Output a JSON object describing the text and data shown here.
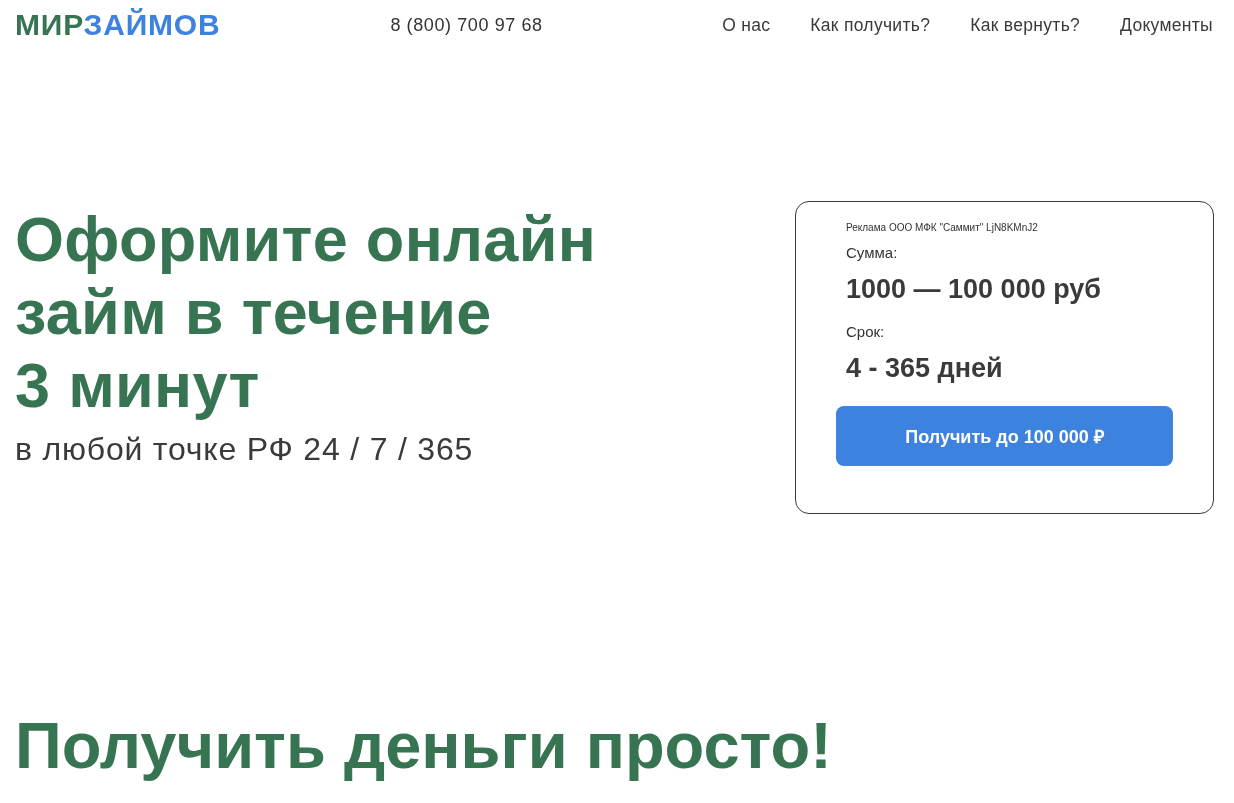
{
  "header": {
    "logo": {
      "part_1": "МИР",
      "part_2": "ЗАЙМОВ"
    },
    "phone": "8 (800) 700 97 68",
    "nav": [
      {
        "label": "О нас"
      },
      {
        "label": "Как получить?"
      },
      {
        "label": "Как вернуть?"
      },
      {
        "label": "Документы"
      }
    ]
  },
  "hero": {
    "title_lines": [
      "Оформите онлайн",
      "займ в течение",
      "3 минут"
    ],
    "subtitle": "в любой точке РФ 24 / 7 / 365"
  },
  "offer_card": {
    "ad_notice": "Реклама ООО МФК \"Саммит\" LjN8KMnJ2",
    "amount_label": "Сумма:",
    "amount_value": "1000 — 100 000 руб",
    "term_label": "Срок:",
    "term_value": "4 - 365 дней",
    "button": "Получить до 100 000 ₽"
  },
  "section_title": "Получить деньги просто!"
}
